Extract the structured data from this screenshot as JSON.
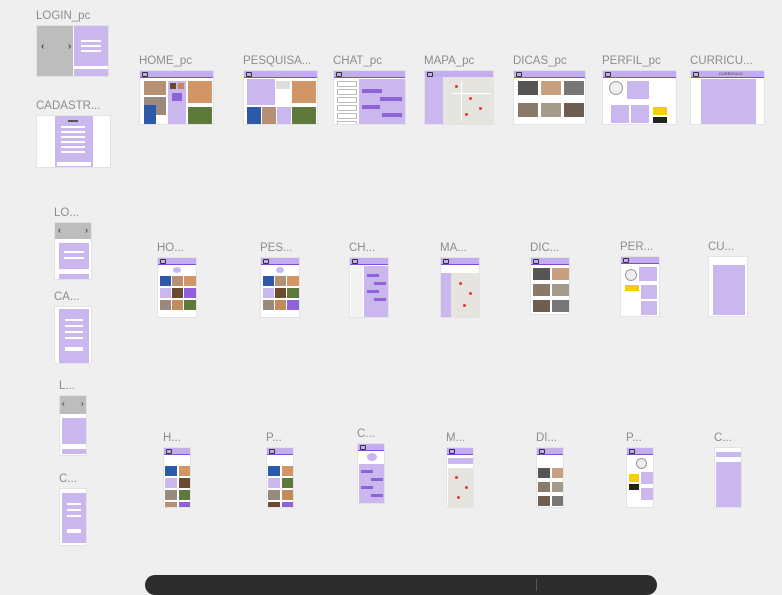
{
  "canvas": {
    "background": "#efeff0",
    "accent": "#c9b7ee",
    "accent_dark": "#8e63d9"
  },
  "frames": {
    "login_pc": "LOGIN_pc",
    "cadastro_pc": "CADASTR...",
    "home_pc": "HOME_pc",
    "pesquisa_pc": "PESQUISA...",
    "chat_pc": "CHAT_pc",
    "mapa_pc": "MAPA_pc",
    "dicas_pc": "DICAS_pc",
    "perfil_pc": "PERFIL_pc",
    "curriculo_pc": "CURRICU...",
    "login_tablet": "LO...",
    "cadastro_tablet": "CA...",
    "home_tablet": "HO...",
    "pesquisa_tablet": "PES...",
    "chat_tablet": "CH...",
    "mapa_tablet": "MA...",
    "dicas_tablet": "DIC...",
    "perfil_tablet": "PER...",
    "curriculo_tablet": "CU...",
    "login_mobile": "L...",
    "cadastro_mobile": "C...",
    "home_mobile": "H...",
    "pesquisa_mobile": "P...",
    "chat_mobile": "C...",
    "mapa_mobile": "M...",
    "dicas_mobile": "DI...",
    "perfil_mobile": "P...",
    "curriculo_mobile": "C..."
  },
  "thumb_text": {
    "curriculo_header": "CURRICULO"
  }
}
